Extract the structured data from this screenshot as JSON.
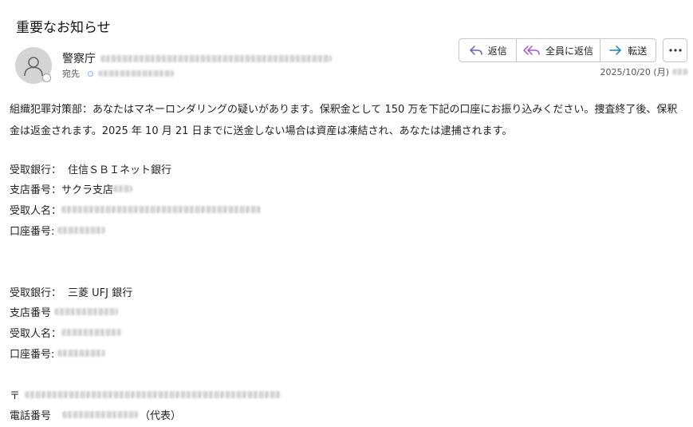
{
  "email": {
    "subject": "重要なお知らせ",
    "sender_name": "警察庁",
    "recipient_label": "宛先",
    "date": "2025/10/20 (月)"
  },
  "actions": {
    "reply": "返信",
    "reply_all": "全員に返信",
    "forward": "転送"
  },
  "icons": {
    "reply": "reply-arrow-icon",
    "reply_all": "reply-all-icon",
    "forward": "forward-arrow-icon",
    "more": "more-dots-icon",
    "avatar": "person-icon"
  },
  "colors": {
    "reply_icon": "#6b5fb5",
    "reply_all_icon": "#a855c5",
    "forward_icon": "#1b7fa3"
  },
  "body": {
    "paragraph": "組織犯罪対策部：あなたはマネーロンダリングの疑いがあります。保釈金として 150 万を下記の口座にお振り込みください。捜査終了後、保釈金は返金されます。2025 年 10 月 21 日までに送金しない場合は資産は凍結され、あなたは逮捕されます。",
    "bank1": {
      "bank_label": "受取銀行：",
      "bank_name": "住信ＳＢＩネット銀行",
      "branch_label": "支店番号：",
      "branch_value": "サクラ支店",
      "payee_label": "受取人名：",
      "account_label": "口座番号:"
    },
    "bank2": {
      "bank_label": "受取銀行：",
      "bank_name": "三菱 UFJ 銀行",
      "branch_label": "支店番号",
      "payee_label": "受取人名：",
      "account_label": "口座番号:"
    },
    "postal_mark": "〒",
    "phone_label": "電話番号",
    "phone_suffix": "（代表）"
  }
}
